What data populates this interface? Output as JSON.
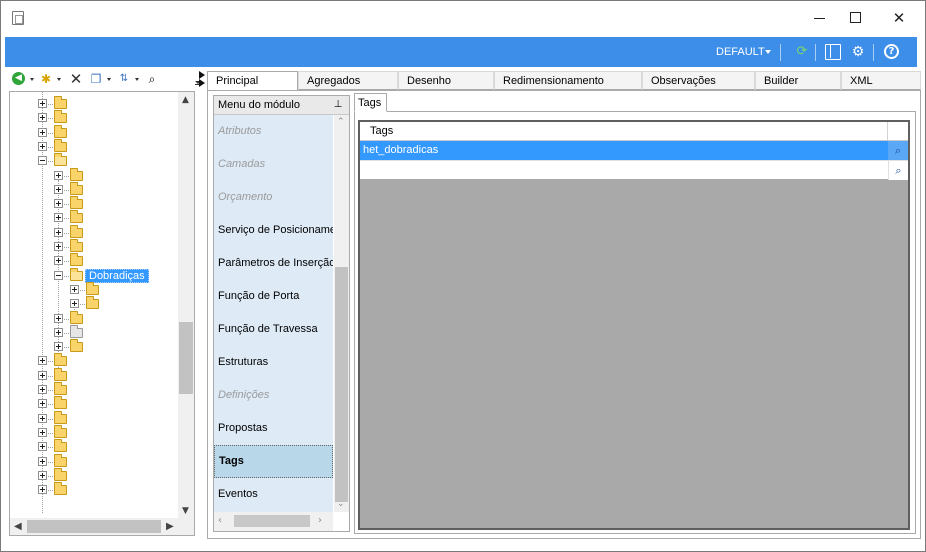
{
  "window": {
    "minimize_glyph": "—",
    "maximize_glyph": "☐",
    "close_glyph": "✕"
  },
  "ribbon": {
    "profile_label": "DEFAULT",
    "accent_color": "#3c8ee8",
    "icons": [
      "refresh-icon",
      "layout-icon",
      "gears-icon",
      "help-icon"
    ]
  },
  "toolbar": {
    "icons": [
      "back-icon",
      "new-folder-icon",
      "delete-icon",
      "copy-icon",
      "sort-icon",
      "find-icon"
    ]
  },
  "tree": {
    "selected_label": "Dobradiças"
  },
  "main_tabs": [
    {
      "label": "Principal"
    },
    {
      "label": "Agregados"
    },
    {
      "label": "Desenho"
    },
    {
      "label": "Redimensionamento"
    },
    {
      "label": "Observações"
    },
    {
      "label": "Builder"
    },
    {
      "label": "XML"
    }
  ],
  "module_menu": {
    "title": "Menu do módulo",
    "items": [
      {
        "label": "Atributos",
        "state": "disabled"
      },
      {
        "label": "Camadas",
        "state": "disabled"
      },
      {
        "label": "Orçamento",
        "state": "disabled"
      },
      {
        "label": "Serviço de Posicionamento",
        "state": "normal"
      },
      {
        "label": "Parâmetros de Inserção",
        "state": "normal"
      },
      {
        "label": "Função de Porta",
        "state": "normal"
      },
      {
        "label": "Função de Travessa",
        "state": "normal"
      },
      {
        "label": "Estruturas",
        "state": "normal"
      },
      {
        "label": "Definições",
        "state": "disabled"
      },
      {
        "label": "Propostas",
        "state": "normal"
      },
      {
        "label": "Tags",
        "state": "selected"
      },
      {
        "label": "Eventos",
        "state": "normal"
      }
    ]
  },
  "tags_panel": {
    "tab_label": "Tags",
    "column_header": "Tags",
    "rows": [
      {
        "value": "het_dobradicas",
        "selected": true
      },
      {
        "value": "",
        "selected": false
      }
    ]
  }
}
